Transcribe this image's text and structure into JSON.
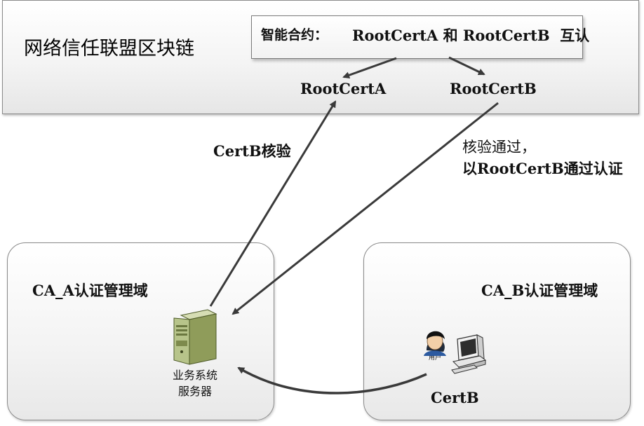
{
  "blockchain": {
    "title": "网络信任联盟区块链",
    "contract_label": "智能合约：",
    "contract_text": "RootCertA 和 RootCertB  互认",
    "root_a": "RootCertA",
    "root_b": "RootCertB"
  },
  "edges": {
    "verify_label": "CertB核验",
    "pass_line1": "核验通过，",
    "pass_line2": "以RootCertB通过认证"
  },
  "domain_a": {
    "title": "CA_A认证管理域",
    "server_line1": "业务系统",
    "server_line2": "服务器"
  },
  "domain_b": {
    "title": "CA_B认证管理域",
    "user_label": "用户",
    "cert_label": "CertB"
  },
  "colors": {
    "arrow": "#3a3a3a",
    "server_body": "#b7c48a",
    "panel_border": "#8a8a8a"
  }
}
